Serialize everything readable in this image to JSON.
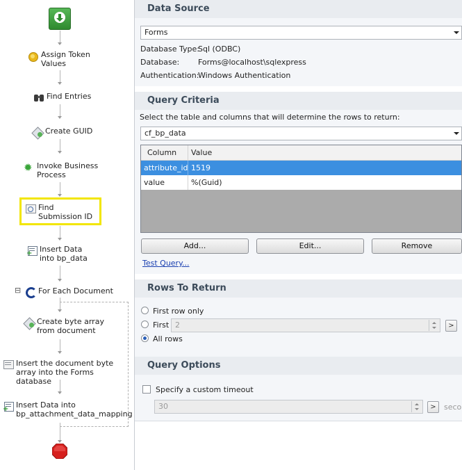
{
  "workflow": {
    "steps": [
      {
        "label": "Assign Token Values",
        "icon": "token-icon"
      },
      {
        "label": "Find Entries",
        "icon": "binoculars-icon"
      },
      {
        "label": "Create GUID",
        "icon": "guid-icon"
      },
      {
        "label": "Invoke Business Process",
        "icon": "gear-icon"
      },
      {
        "label": "Find Submission ID",
        "icon": "search-document-icon"
      },
      {
        "label": "Insert Data into bp_data",
        "icon": "insert-data-icon"
      },
      {
        "label": "For Each Document",
        "icon": "loop-icon"
      },
      {
        "label": "Create byte array from document",
        "icon": "byte-array-icon"
      },
      {
        "label": "Insert the document byte array into the Forms database",
        "icon": "database-icon"
      },
      {
        "label": "Insert Data into bp_attachment_data_mapping",
        "icon": "insert-data-icon"
      }
    ],
    "collapse_symbol": "⊟",
    "highlight_color": "#f2e600"
  },
  "data_source": {
    "title": "Data Source",
    "selected": "Forms",
    "db_type_label": "Database Type:",
    "db_type_value": "Sql (ODBC)",
    "database_label": "Database:",
    "database_value": "Forms@localhost\\sqlexpress",
    "auth_label": "Authentication:",
    "auth_value": "Windows Authentication"
  },
  "query_criteria": {
    "title": "Query Criteria",
    "instruction": "Select the table and columns that will determine the rows to return:",
    "table": "cf_bp_data",
    "columns_header": [
      "Column",
      "Value"
    ],
    "rows": [
      {
        "column": "attribute_id",
        "value": "1519",
        "selected": true
      },
      {
        "column": "value",
        "value": "%(Guid)",
        "selected": false
      }
    ],
    "add_label": "Add...",
    "edit_label": "Edit...",
    "remove_label": "Remove",
    "test_query_label": "Test Query..."
  },
  "rows_to_return": {
    "title": "Rows To Return",
    "first_row_only": "First row only",
    "first": "First",
    "first_value": "2",
    "all_rows": "All rows",
    "selected": "all_rows",
    "more_label": ">"
  },
  "query_options": {
    "title": "Query Options",
    "custom_timeout_label": "Specify a custom timeout",
    "custom_timeout_checked": false,
    "timeout_value": "30",
    "more_label": ">",
    "unit_label": "secor"
  },
  "colors": {
    "start": "#3c9a3c",
    "stop": "#d6201e",
    "selection": "#3c8fe0",
    "section_header": "#e9ecf0"
  }
}
